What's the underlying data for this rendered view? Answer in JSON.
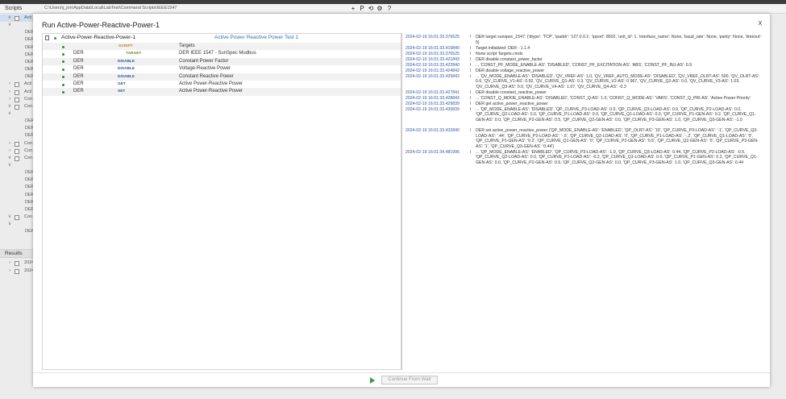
{
  "app": {
    "panel_title": "Scripts",
    "path": "C:\\Users\\j_jon\\AppData\\Local\\LabTest\\Command Scripts\\IEEE1547",
    "toolbar_icons": [
      "plus-icon",
      "p-icon",
      "refresh-icon",
      "settings-icon",
      "help-icon"
    ],
    "toolbar_glyphs": [
      "+",
      "P",
      "⟲",
      "⚙",
      "?"
    ]
  },
  "sidebar": {
    "rows": [
      {
        "caret": "∨",
        "label": "Acti",
        "selected": true
      },
      {
        "caret": "∨",
        "label": ""
      },
      {
        "caret": "",
        "label": "DER"
      },
      {
        "caret": "",
        "label": "DER"
      },
      {
        "caret": "",
        "label": "DER"
      },
      {
        "caret": "",
        "label": "DER"
      },
      {
        "caret": "",
        "label": "DER"
      },
      {
        "caret": "",
        "label": "DER"
      },
      {
        "caret": "",
        "label": "DER"
      },
      {
        "caret": "›",
        "label": "Acti"
      },
      {
        "caret": "›",
        "label": "Acti"
      },
      {
        "caret": "›",
        "label": "Con"
      },
      {
        "caret": "∨",
        "label": "Con"
      },
      {
        "caret": "∨",
        "label": ""
      },
      {
        "caret": "",
        "label": "DER"
      },
      {
        "caret": "",
        "label": "DER"
      },
      {
        "caret": "",
        "label": "DER"
      },
      {
        "caret": "›",
        "label": "Con"
      },
      {
        "caret": "›",
        "label": "Con"
      },
      {
        "caret": "∨",
        "label": "Con"
      },
      {
        "caret": "∨",
        "label": ""
      },
      {
        "caret": "",
        "label": "DER"
      },
      {
        "caret": "",
        "label": "DER"
      },
      {
        "caret": "",
        "label": "DER"
      },
      {
        "caret": "",
        "label": "DER"
      },
      {
        "caret": "",
        "label": "DER"
      },
      {
        "caret": "",
        "label": "DER"
      },
      {
        "caret": "∨",
        "label": "Con"
      },
      {
        "caret": "∨",
        "label": ""
      },
      {
        "caret": "",
        "label": "DER"
      }
    ],
    "results_title": "Results",
    "results": [
      {
        "caret": "›",
        "label": "2024"
      },
      {
        "caret": "›",
        "label": "2024"
      }
    ]
  },
  "dialog": {
    "title": "Run Active-Power-Reactive-Power-1",
    "close": "x",
    "script_name": "Active-Power-Reactive-Power-1",
    "script_description": "Active Power Reactive Power Test 1",
    "steps": [
      {
        "c1": "",
        "c2": "SCRIPT",
        "c2_color": "#b58a2a",
        "c3": "Targets"
      },
      {
        "c1": "DER",
        "c2": "TARGET",
        "c2_color": "#6b8a2a",
        "c3": "DER IEEE 1547 - SunSpec Modbus"
      },
      {
        "c1": "DER",
        "c2": "DISABLE",
        "c2_color": "#2f56a3",
        "c3": "Constant Power Factor"
      },
      {
        "c1": "DER",
        "c2": "DISABLE",
        "c2_color": "#2f56a3",
        "c3": "Voltage-Reactive Power"
      },
      {
        "c1": "DER",
        "c2": "DISABLE",
        "c2_color": "#2f56a3",
        "c3": "Constant Reactive Power"
      },
      {
        "c1": "DER",
        "c2": "GET",
        "c2_color": "#2f56a3",
        "c3": "Active Power-Reactive Power"
      },
      {
        "c1": "DER",
        "c2": "SET",
        "c2_color": "#2f56a3",
        "c3": "Active Power-Reactive Power"
      }
    ],
    "log": [
      {
        "ts": "2024-02-19 16:01:33.376525",
        "sep": "I",
        "msg": "DER target sunspec_1547: {'dtype': 'TCP', 'ipaddr': '127.0.0.1', 'ipport': 8502, 'unit_id': 1, 'interface_name': None, 'baud_rate': None, 'parity': None, 'timeout': 5}",
        "lines": 2
      },
      {
        "ts": "2024-02-19 16:01:33.419840",
        "sep": "I",
        "msg": "Target initialized: DER - 1.1.4",
        "lines": 1
      },
      {
        "ts": "2024-02-19 16:01:33.376525",
        "sep": "I",
        "msg": "None script Targets.cmds",
        "lines": 1
      },
      {
        "ts": "2024-02-19 16:01:33.421843",
        "sep": "I",
        "msg": "DER disable constant_power_factor",
        "lines": 1
      },
      {
        "ts": "2024-02-19 16:01:33.422840",
        "sep": "I",
        "msg": "... 'CONST_PF_MODE_ENABLE-AS': 'DISABLED', 'CONST_PF_EXCITATION-AS': 'ABS', 'CONST_PF_INJ-AS': 0.9",
        "lines": 1
      },
      {
        "ts": "2024-02-19 16:01:33.424842",
        "sep": "I",
        "msg": "DER disable voltage_reactive_power",
        "lines": 1
      },
      {
        "ts": "2024-02-19 16:01:33.425842",
        "sep": "I",
        "msg": "... 'QV_MODE_ENABLE-AS': 'DISABLED', 'QV_VREF-AS': 1.0, 'QV_VREF_AUTO_MODE-AS': 'DISABLED', 'QV_VREF_OLRT-AS': 500, 'QV_OLRT-AS': 0.6, 'QV_CURVE_V1-AS': 0.92, 'QV_CURVE_Q1-AS': 0.3, 'QV_CURVE_V2-AS': 0.967, 'QV_CURVE_Q2-AS': 0.0, 'QV_CURVE_V3-AS': 1.03, 'QV_CURVE_Q3-AS': 0.0, 'QV_CURVE_V4-AS': 1.07, 'QV_CURVE_Q4-AS': -0.3",
        "lines": 3
      },
      {
        "ts": "2024-02-19 16:01:33.427841",
        "sep": "I",
        "msg": "DER disable constant_reactive_power",
        "lines": 1
      },
      {
        "ts": "2024-02-19 16:01:33.428843",
        "sep": "I",
        "msg": "... 'CONST_Q_MODE_ENABLE-AS': 'DISABLED', 'CONST_Q-AS': 1.0, 'CONST_Q_MODE-AS': 'VARS', 'CONST_Q_PRI-AS': 'Active Power Priority'",
        "lines": 1
      },
      {
        "ts": "2024-02-19 16:01:33.429839",
        "sep": "I",
        "msg": "DER get active_power_reactive_power",
        "lines": 1
      },
      {
        "ts": "2024-02-19 16:01:33.430839",
        "sep": "I",
        "msg": "... 'QP_MODE_ENABLE-AS': 'DISABLED', 'QP_CURVE_P3-LOAD-AS': 0.0, 'QP_CURVE_Q3-LOAD-AS': 0.0, 'QP_CURVE_P2-LOAD-AS': 0.0, 'QP_CURVE_Q2-LOAD-AS': 0.0, 'QP_CURVE_P1-LOAD-AS': 0.0, 'QP_CURVE_Q1-LOAD-AS': 0.0, 'QP_CURVE_P1-GEN-AS': 0.2, 'QP_CURVE_Q1-GEN-AS': 0.0, 'QP_CURVE_P2-GEN-AS': 0.5, 'QP_CURVE_Q2-GEN-AS': 0.0, 'QP_CURVE_P3-GEN-AS': 1.0, 'QP_CURVE_Q3-GEN-AS': -1.0",
        "lines": 4
      },
      {
        "ts": "2024-02-19 16:01:33.432840",
        "sep": "I",
        "msg": "DER set active_power_reactive_power {'QP_MODE_ENABLE-AS': 'ENABLED', 'QP_OLRT-AS': '10', 'QP_CURVE_P3-LOAD-AS': '-1', 'QP_CURVE_Q3-LOAD-AS': '.44', 'QP_CURVE_P2-LOAD-AS': '-.5', 'QP_CURVE_Q2-LOAD-AS': '0', 'QP_CURVE_P1-LOAD-AS': '-.2', 'QP_CURVE_Q1-LOAD-AS': '0', 'QP_CURVE_P1-GEN-AS': '0.2', 'QP_CURVE_Q1-GEN-AS': '0', 'QP_CURVE_P2-GEN-AS': '0.5', 'QP_CURVE_Q2-GEN-AS': '0', 'QP_CURVE_P3-GEN-AS': '1', 'QP_CURVE_Q3-GEN-AS': '0.44'}",
        "lines": 4
      },
      {
        "ts": "2024-02-19 16:01:34.481996",
        "sep": "I",
        "msg": "... 'QP_MODE_ENABLE-AS': 'ENABLED', 'QP_CURVE_P3-LOAD-AS': -1.0, 'QP_CURVE_Q3-LOAD-AS': 0.44, 'QP_CURVE_P2-LOAD-AS': -0.5, 'QP_CURVE_Q2-LOAD-AS': 0.0, 'QP_CURVE_P1-LOAD-AS': -0.2, 'QP_CURVE_Q1-LOAD-AS': 0.0, 'QP_CURVE_P1-GEN-AS': 0.2, 'QP_CURVE_Q1-GEN-AS': 0.0, 'QP_CURVE_P2-GEN-AS': 0.5, 'QP_CURVE_Q2-GEN-AS': 0.0, 'QP_CURVE_P3-GEN-AS': 1.0, 'QP_CURVE_Q3-GEN-AS': 0.44",
        "lines": 3
      }
    ],
    "continue_label": "Continue From Wait",
    "run_icon": "play-icon"
  }
}
